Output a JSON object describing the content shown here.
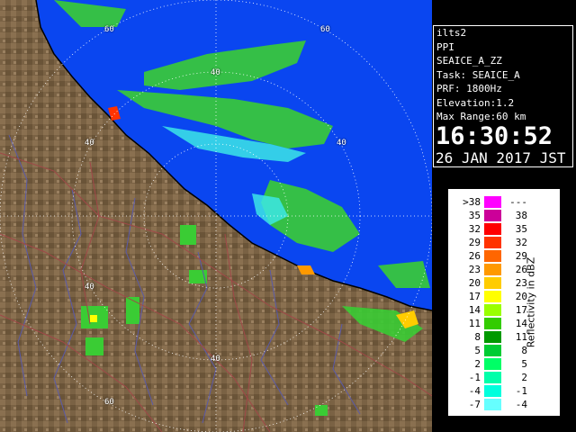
{
  "radar": {
    "range_rings": [
      "40",
      "60"
    ],
    "ring_labels": [
      "60",
      "60",
      "40",
      "40",
      "40",
      "40",
      "40",
      "60"
    ]
  },
  "info": {
    "station": "ilts2",
    "product": "PPI",
    "field": "SEAICE_A_ZZ",
    "task": "Task: SEAICE_A",
    "prf": "PRF: 1800Hz",
    "elevation": "Elevation:1.2",
    "max_range": "Max Range:60 km",
    "time": "16:30:52",
    "date": "26 JAN 2017 JST"
  },
  "legend": {
    "title": "Reflectivity in dBZ",
    "rows": [
      {
        "low": ">38",
        "high": "---",
        "color": "#ff00ff"
      },
      {
        "low": "35",
        "high": "38",
        "color": "#cc0099"
      },
      {
        "low": "32",
        "high": "35",
        "color": "#ff0000"
      },
      {
        "low": "29",
        "high": "32",
        "color": "#ff3300"
      },
      {
        "low": "26",
        "high": "29",
        "color": "#ff6600"
      },
      {
        "low": "23",
        "high": "26",
        "color": "#ff9900"
      },
      {
        "low": "20",
        "high": "23",
        "color": "#ffcc00"
      },
      {
        "low": "17",
        "high": "20",
        "color": "#ffff00"
      },
      {
        "low": "14",
        "high": "17",
        "color": "#99ff00"
      },
      {
        "low": "11",
        "high": "14",
        "color": "#33cc00"
      },
      {
        "low": "8",
        "high": "11",
        "color": "#009900"
      },
      {
        "low": "5",
        "high": "8",
        "color": "#00cc33"
      },
      {
        "low": "2",
        "high": "5",
        "color": "#00ff66"
      },
      {
        "low": "-1",
        "high": "2",
        "color": "#00ffaa"
      },
      {
        "low": "-4",
        "high": "-1",
        "color": "#00ffdd"
      },
      {
        "low": "-7",
        "high": "-4",
        "color": "#66ffff"
      }
    ]
  },
  "colors": {
    "land": "#7a6244",
    "sea": "#0a46f0",
    "echo_green": "#3acc34",
    "echo_cyan": "#3ce6e6",
    "rivers": "#5a5aa8",
    "borders": "#a04848"
  }
}
